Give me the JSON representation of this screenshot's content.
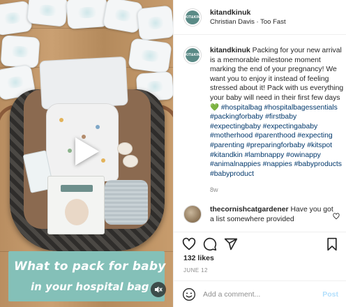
{
  "media": {
    "overlay_line1": "What to pack for baby",
    "overlay_line2": "in your hospital bag",
    "play_icon": "play-icon",
    "mute_icon": "mute-icon",
    "overlay_color": "#84c0b8"
  },
  "header": {
    "avatar_text": "KIT&KIN",
    "username": "kitandkinuk",
    "audio": "Christian Davis · Too Fast"
  },
  "caption": {
    "avatar_text": "KIT&KIN",
    "username": "kitandkinuk",
    "text": " Packing for your new arrival is a memorable milestone moment marking the end of your pregnancy! We want you to enjoy it instead of feeling stressed about it! Pack with us everything your baby will need in their first few days 💚",
    "hashtags": "#hospitalbag #hospitalbagessentials #packingforbaby #firstbaby #expectingbaby #expectingababy #motherhood #parenthood #expecting #parenting #preparingforbaby #kitspot #kitandkin #lambnappy #owinappy #animalnappies #nappies #babyproducts #babyproduct",
    "time_ago": "8w"
  },
  "comment": {
    "username": "thecornishcatgardener",
    "text": " Have you got a list somewhere provided"
  },
  "actions": {
    "like_icon": "heart-icon",
    "comment_icon": "comment-icon",
    "share_icon": "share-icon",
    "save_icon": "bookmark-icon"
  },
  "likes": "132 likes",
  "date": "JUNE 12",
  "add_comment": {
    "placeholder": "Add a comment...",
    "post_label": "Post",
    "emoji_icon": "emoji-icon"
  },
  "colors": {
    "link": "#00376b",
    "muted": "#8e8e8e",
    "post_disabled": "#b2dffc",
    "brand": "#5a8a86"
  }
}
